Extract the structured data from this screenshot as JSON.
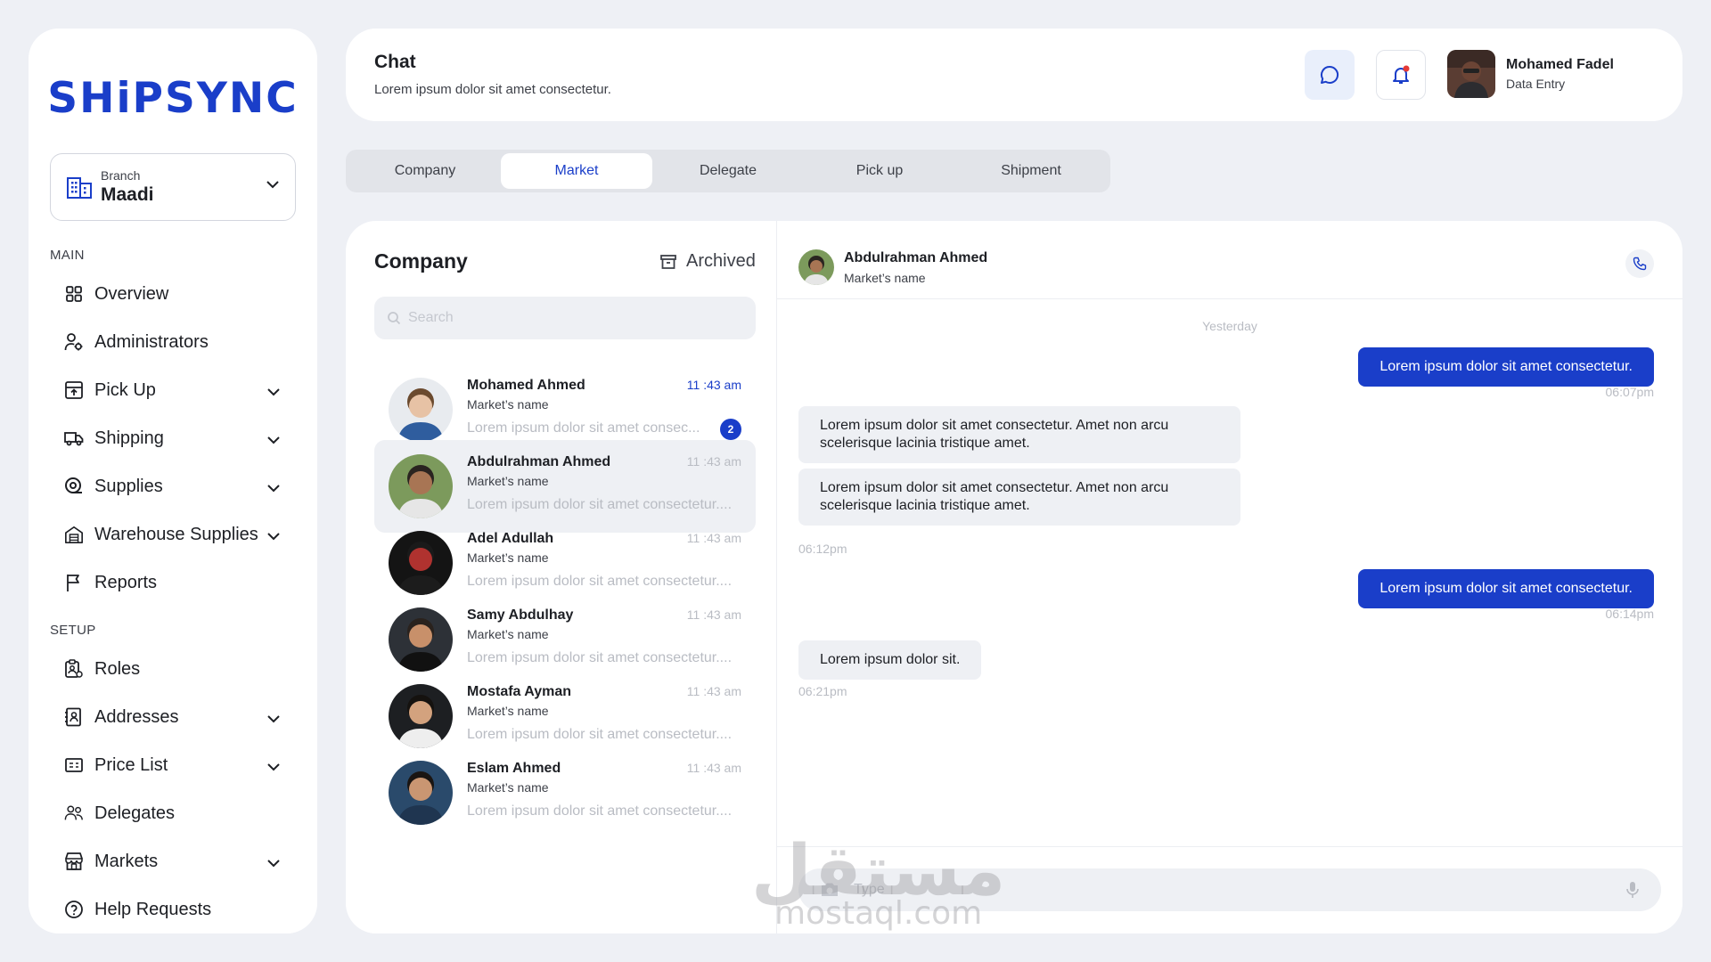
{
  "brand": {
    "logo_text": "SHiPSYNC",
    "accent": "#1a3ec9"
  },
  "branch": {
    "label": "Branch",
    "value": "Maadi",
    "icon": "building-icon"
  },
  "sidebar": {
    "main_label": "MAIN",
    "setup_label": "SETUP",
    "main_items": [
      {
        "label": "Overview",
        "icon": "grid-icon",
        "expandable": false
      },
      {
        "label": "Administrators",
        "icon": "user-gear-icon",
        "expandable": false
      },
      {
        "label": "Pick Up",
        "icon": "box-upload-icon",
        "expandable": true
      },
      {
        "label": "Shipping",
        "icon": "truck-icon",
        "expandable": true
      },
      {
        "label": "Supplies",
        "icon": "tape-icon",
        "expandable": true
      },
      {
        "label": "Warehouse Supplies",
        "icon": "warehouse-icon",
        "expandable": true
      },
      {
        "label": "Reports",
        "icon": "flag-icon",
        "expandable": false
      }
    ],
    "setup_items": [
      {
        "label": "Roles",
        "icon": "clipboard-user-icon",
        "expandable": false
      },
      {
        "label": "Addresses",
        "icon": "contact-book-icon",
        "expandable": true
      },
      {
        "label": "Price List",
        "icon": "price-tag-icon",
        "expandable": true
      },
      {
        "label": "Delegates",
        "icon": "people-icon",
        "expandable": false
      },
      {
        "label": "Markets",
        "icon": "store-icon",
        "expandable": true
      },
      {
        "label": "Help Requests",
        "icon": "question-circle-icon",
        "expandable": false
      }
    ]
  },
  "header": {
    "title": "Chat",
    "subtitle": "Lorem ipsum dolor sit amet consectetur.",
    "user_name": "Mohamed Fadel",
    "user_role": "Data Entry"
  },
  "tabs": [
    {
      "label": "Company",
      "active": false
    },
    {
      "label": "Market",
      "active": true
    },
    {
      "label": "Delegate",
      "active": false
    },
    {
      "label": "Pick up",
      "active": false
    },
    {
      "label": "Shipment",
      "active": false
    }
  ],
  "list": {
    "title": "Company",
    "archived_label": "Archived",
    "search_placeholder": "Search",
    "conversations": [
      {
        "name": "Mohamed Ahmed",
        "sub": "Market’s name",
        "preview": "Lorem ipsum dolor sit amet consec...",
        "time": "11 :43 am",
        "unread": "2",
        "selected": false,
        "time_highlight": true
      },
      {
        "name": "Abdulrahman Ahmed",
        "sub": "Market’s name",
        "preview": "Lorem ipsum dolor sit amet consectetur....",
        "time": "11 :43 am",
        "unread": "",
        "selected": true,
        "time_highlight": false
      },
      {
        "name": "Adel Adullah",
        "sub": "Market’s name",
        "preview": "Lorem ipsum dolor sit amet consectetur....",
        "time": "11 :43 am",
        "unread": "",
        "selected": false,
        "time_highlight": false
      },
      {
        "name": "Samy Abdulhay",
        "sub": "Market’s name",
        "preview": "Lorem ipsum dolor sit amet consectetur....",
        "time": "11 :43 am",
        "unread": "",
        "selected": false,
        "time_highlight": false
      },
      {
        "name": "Mostafa Ayman",
        "sub": "Market’s name",
        "preview": "Lorem ipsum dolor sit amet consectetur....",
        "time": "11 :43 am",
        "unread": "",
        "selected": false,
        "time_highlight": false
      },
      {
        "name": "Eslam Ahmed",
        "sub": "Market’s name",
        "preview": "Lorem ipsum dolor sit amet consectetur....",
        "time": "11 :43 am",
        "unread": "",
        "selected": false,
        "time_highlight": false
      }
    ]
  },
  "conversation": {
    "name": "Abdulrahman Ahmed",
    "sub": "Market’s name",
    "day_label": "Yesterday",
    "messages": [
      {
        "dir": "out",
        "text": "Lorem ipsum dolor sit amet consectetur.",
        "time": "06:07pm"
      },
      {
        "dir": "in",
        "text": "Lorem ipsum dolor sit amet consectetur. Amet non arcu scelerisque lacinia tristique amet.",
        "time": ""
      },
      {
        "dir": "in",
        "text": "Lorem ipsum dolor sit amet consectetur. Amet non arcu scelerisque lacinia tristique amet.",
        "time": "06:12pm"
      },
      {
        "dir": "out",
        "text": "Lorem ipsum dolor sit amet consectetur.",
        "time": "06:14pm"
      },
      {
        "dir": "in",
        "text": "Lorem ipsum dolor sit.",
        "time": "06:21pm"
      }
    ],
    "input_placeholder": "Type"
  },
  "watermark": {
    "line1": "مستقل",
    "line2": "mostaql.com"
  }
}
